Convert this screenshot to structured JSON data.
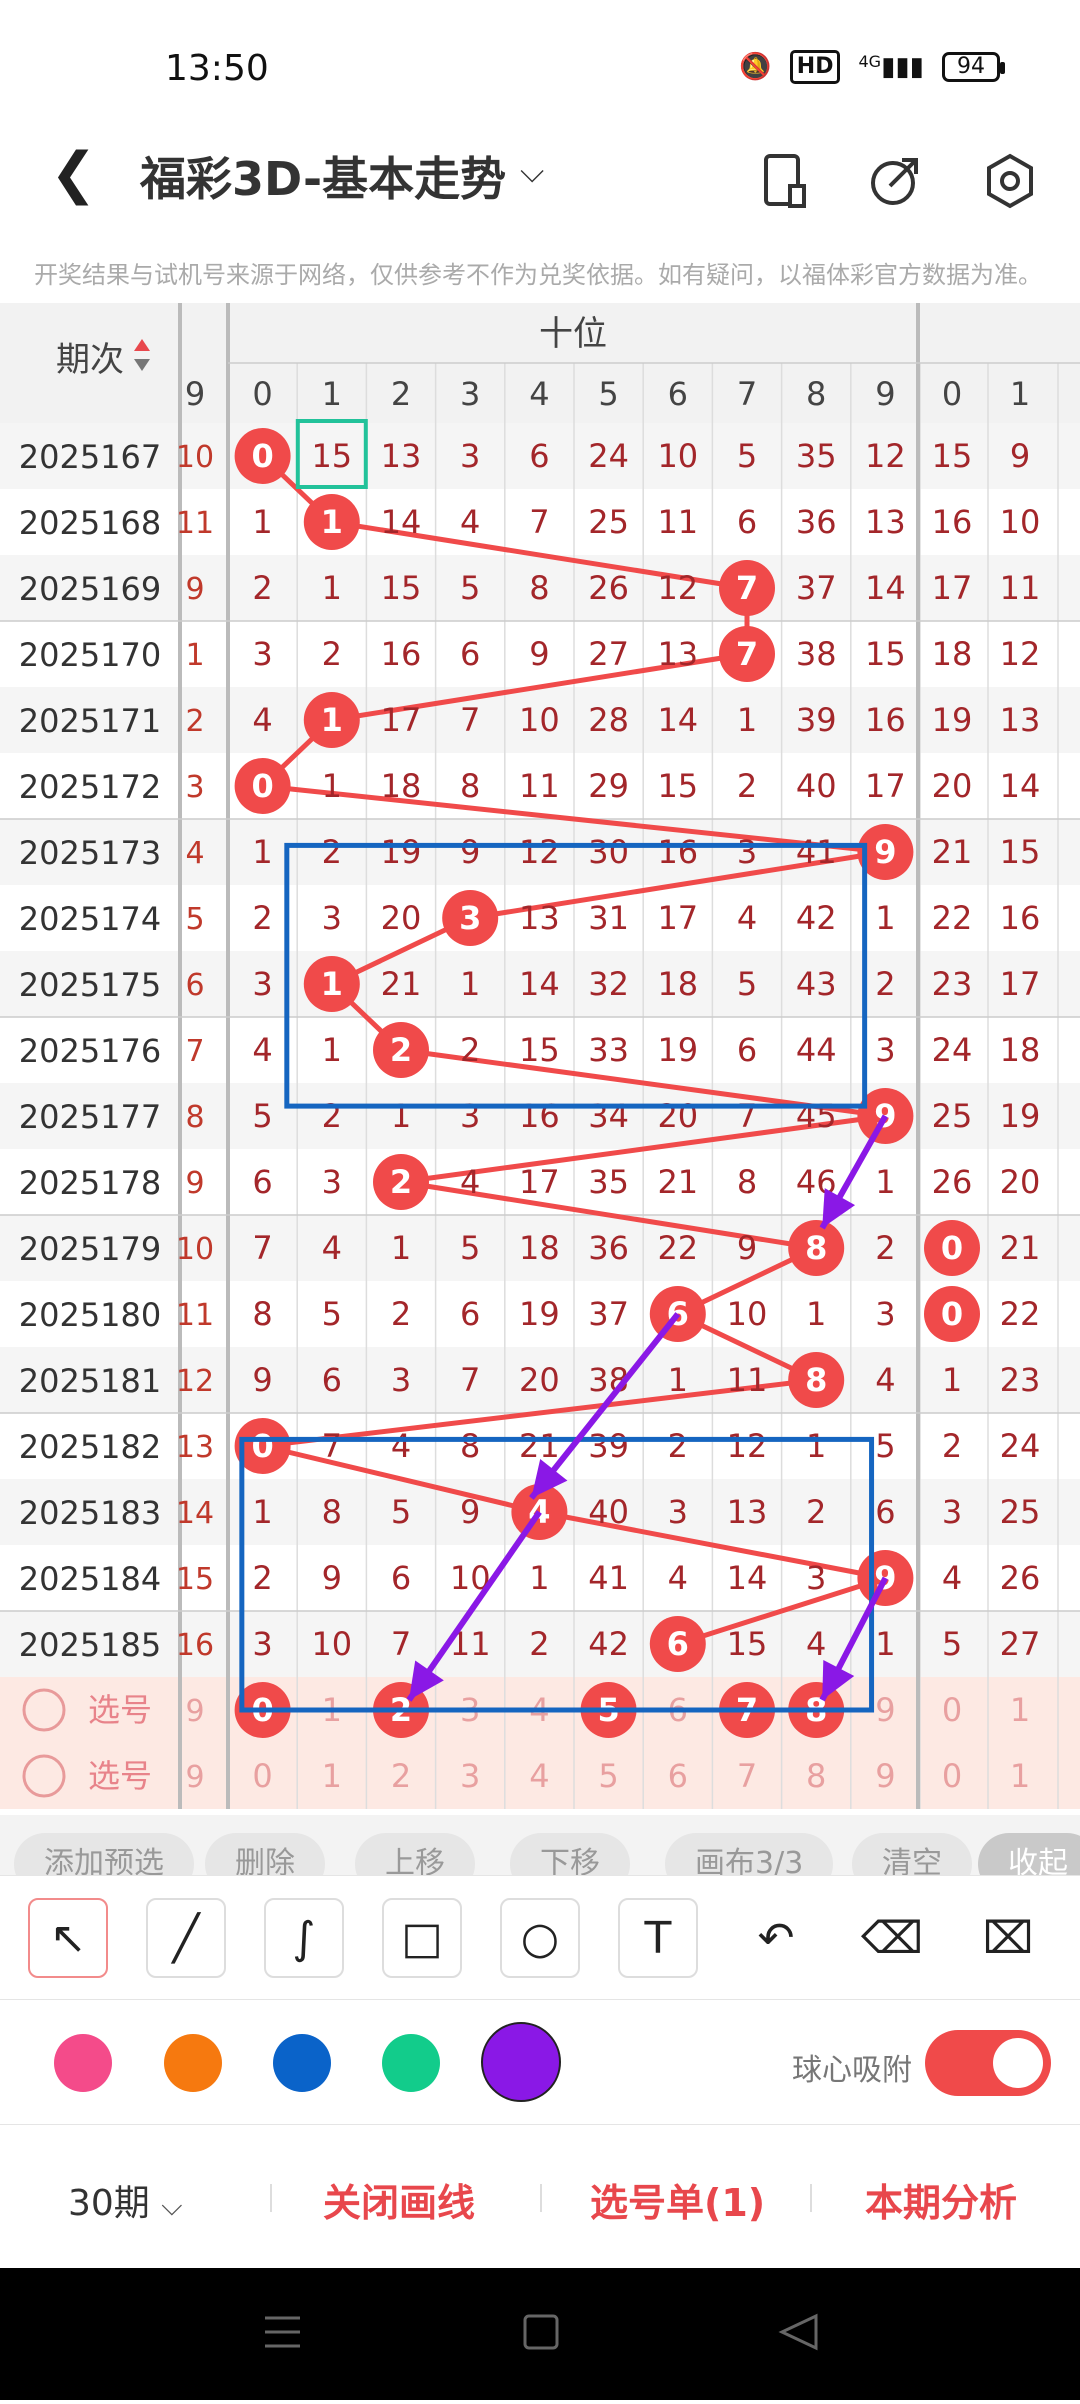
{
  "status_bar": {
    "time": "13:50",
    "hd": "HD",
    "network": "4G",
    "battery": "94"
  },
  "header": {
    "title": "福彩3D-基本走势"
  },
  "notice": "开奖结果与试机号来源于网络，仅供参考不作为兑奖依据。如有疑问，以福体彩官方数据为准。",
  "grid": {
    "period_header": "期次",
    "section_label": "十位",
    "left_col_header": "9",
    "digit_headers": [
      "0",
      "1",
      "2",
      "3",
      "4",
      "5",
      "6",
      "7",
      "8",
      "9"
    ],
    "next_headers": [
      "0",
      "1"
    ],
    "rows": [
      {
        "period": "2025167",
        "left": "10",
        "cells": [
          "0",
          "15",
          "13",
          "3",
          "6",
          "24",
          "10",
          "5",
          "35",
          "12"
        ],
        "next": [
          "15",
          "9"
        ],
        "hit": 0
      },
      {
        "period": "2025168",
        "left": "11",
        "cells": [
          "1",
          "1",
          "14",
          "4",
          "7",
          "25",
          "11",
          "6",
          "36",
          "13"
        ],
        "next": [
          "16",
          "10"
        ],
        "hit": 1
      },
      {
        "period": "2025169",
        "left": "9",
        "cells": [
          "2",
          "1",
          "15",
          "5",
          "8",
          "26",
          "12",
          "7",
          "37",
          "14"
        ],
        "next": [
          "17",
          "11"
        ],
        "hit": 7
      },
      {
        "period": "2025170",
        "left": "1",
        "cells": [
          "3",
          "2",
          "16",
          "6",
          "9",
          "27",
          "13",
          "7",
          "38",
          "15"
        ],
        "next": [
          "18",
          "12"
        ],
        "hit": 7
      },
      {
        "period": "2025171",
        "left": "2",
        "cells": [
          "4",
          "1",
          "17",
          "7",
          "10",
          "28",
          "14",
          "1",
          "39",
          "16"
        ],
        "next": [
          "19",
          "13"
        ],
        "hit": 1
      },
      {
        "period": "2025172",
        "left": "3",
        "cells": [
          "0",
          "1",
          "18",
          "8",
          "11",
          "29",
          "15",
          "2",
          "40",
          "17"
        ],
        "next": [
          "20",
          "14"
        ],
        "hit": 0
      },
      {
        "period": "2025173",
        "left": "4",
        "cells": [
          "1",
          "2",
          "19",
          "9",
          "12",
          "30",
          "16",
          "3",
          "41",
          "9"
        ],
        "next": [
          "21",
          "15"
        ],
        "hit": 9
      },
      {
        "period": "2025174",
        "left": "5",
        "cells": [
          "2",
          "3",
          "20",
          "3",
          "13",
          "31",
          "17",
          "4",
          "42",
          "1"
        ],
        "next": [
          "22",
          "16"
        ],
        "hit": 3
      },
      {
        "period": "2025175",
        "left": "6",
        "cells": [
          "3",
          "1",
          "21",
          "1",
          "14",
          "32",
          "18",
          "5",
          "43",
          "2"
        ],
        "next": [
          "23",
          "17"
        ],
        "hit": 1
      },
      {
        "period": "2025176",
        "left": "7",
        "cells": [
          "4",
          "1",
          "2",
          "2",
          "15",
          "33",
          "19",
          "6",
          "44",
          "3"
        ],
        "next": [
          "24",
          "18"
        ],
        "hit": 2
      },
      {
        "period": "2025177",
        "left": "8",
        "cells": [
          "5",
          "2",
          "1",
          "3",
          "16",
          "34",
          "20",
          "7",
          "45",
          "9"
        ],
        "next": [
          "25",
          "19"
        ],
        "hit": 9
      },
      {
        "period": "2025178",
        "left": "9",
        "cells": [
          "6",
          "3",
          "2",
          "4",
          "17",
          "35",
          "21",
          "8",
          "46",
          "1"
        ],
        "next": [
          "26",
          "20"
        ],
        "hit": 2
      },
      {
        "period": "2025179",
        "left": "10",
        "cells": [
          "7",
          "4",
          "1",
          "5",
          "18",
          "36",
          "22",
          "9",
          "8",
          "2"
        ],
        "next": [
          "0",
          "21"
        ],
        "hit": 8
      },
      {
        "period": "2025180",
        "left": "11",
        "cells": [
          "8",
          "5",
          "2",
          "6",
          "19",
          "37",
          "6",
          "10",
          "1",
          "3"
        ],
        "next": [
          "0",
          "22"
        ],
        "hit": 6
      },
      {
        "period": "2025181",
        "left": "12",
        "cells": [
          "9",
          "6",
          "3",
          "7",
          "20",
          "38",
          "1",
          "11",
          "8",
          "4"
        ],
        "next": [
          "1",
          "23"
        ],
        "hit": 8
      },
      {
        "period": "2025182",
        "left": "13",
        "cells": [
          "0",
          "7",
          "4",
          "8",
          "21",
          "39",
          "2",
          "12",
          "1",
          "5"
        ],
        "next": [
          "2",
          "24"
        ],
        "hit": 0
      },
      {
        "period": "2025183",
        "left": "14",
        "cells": [
          "1",
          "8",
          "5",
          "9",
          "4",
          "40",
          "3",
          "13",
          "2",
          "6"
        ],
        "next": [
          "3",
          "25"
        ],
        "hit": 4
      },
      {
        "period": "2025184",
        "left": "15",
        "cells": [
          "2",
          "9",
          "6",
          "10",
          "1",
          "41",
          "4",
          "14",
          "3",
          "9"
        ],
        "next": [
          "4",
          "26"
        ],
        "hit": 9
      },
      {
        "period": "2025185",
        "left": "16",
        "cells": [
          "3",
          "10",
          "7",
          "11",
          "2",
          "42",
          "6",
          "15",
          "4",
          "1"
        ],
        "next": [
          "5",
          "27"
        ],
        "hit": 6
      }
    ],
    "pick_rows": [
      {
        "label": "选号",
        "left": "9",
        "cells": [
          "0",
          "1",
          "2",
          "3",
          "4",
          "5",
          "6",
          "7",
          "8",
          "9"
        ],
        "next": [
          "0",
          "1"
        ],
        "selected": [
          0,
          2,
          5,
          7,
          8
        ]
      },
      {
        "label": "选号",
        "left": "9",
        "cells": [
          "0",
          "1",
          "2",
          "3",
          "4",
          "5",
          "6",
          "7",
          "8",
          "9"
        ],
        "next": [
          "0",
          "1"
        ],
        "selected": []
      }
    ]
  },
  "actions": [
    "添加预选",
    "删除",
    "上移",
    "下移",
    "画布3/3",
    "清空",
    "收起"
  ],
  "draw_tools": [
    "arrow-tool",
    "line-tool",
    "curve-tool",
    "rect-tool",
    "circle-tool",
    "text-tool",
    "undo",
    "eraser",
    "clear-brush"
  ],
  "palette": [
    "#f44b8a",
    "#f6790f",
    "#0a63c9",
    "#12cc8b",
    "#8a18e6"
  ],
  "magnet_label": "球心吸附",
  "bottom": {
    "period_select": "30期",
    "close_draw": "关闭画线",
    "pick_list": "选号单(1)",
    "analysis": "本期分析"
  },
  "colors": {
    "ball": "#f04a4a",
    "accent": "#e8474c",
    "box": "#1565c0",
    "arrow": "#8a18e6"
  }
}
